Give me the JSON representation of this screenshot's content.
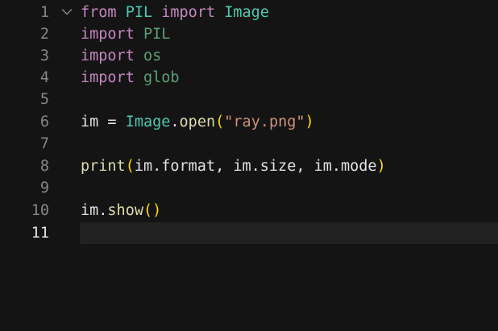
{
  "colors": {
    "background": "#141414",
    "current_line": "#212121",
    "gutter_text": "#868686",
    "keyword": "#c586c0",
    "module": "#4ec9b0",
    "function": "#dcdcaa",
    "string": "#ce9178",
    "bracket": "#ffd700"
  },
  "editor": {
    "current_line": 11,
    "lines": [
      {
        "number": "1",
        "tokens": [
          "from",
          "PIL",
          "import",
          "Image"
        ]
      },
      {
        "number": "2",
        "tokens": [
          "import",
          "PIL"
        ]
      },
      {
        "number": "3",
        "tokens": [
          "import",
          "os"
        ]
      },
      {
        "number": "4",
        "tokens": [
          "import",
          "glob"
        ]
      },
      {
        "number": "5",
        "tokens": []
      },
      {
        "number": "6",
        "tokens": [
          "im",
          "=",
          "Image",
          ".",
          "open",
          "(",
          "\"ray.png\"",
          ")"
        ]
      },
      {
        "number": "7",
        "tokens": []
      },
      {
        "number": "8",
        "tokens": [
          "print",
          "(",
          "im.format, im.size, im.mode",
          ")"
        ]
      },
      {
        "number": "9",
        "tokens": []
      },
      {
        "number": "10",
        "tokens": [
          "im.",
          "show",
          "(",
          ")"
        ]
      },
      {
        "number": "11",
        "tokens": []
      }
    ],
    "fold_icon": "chevron-down-icon"
  }
}
